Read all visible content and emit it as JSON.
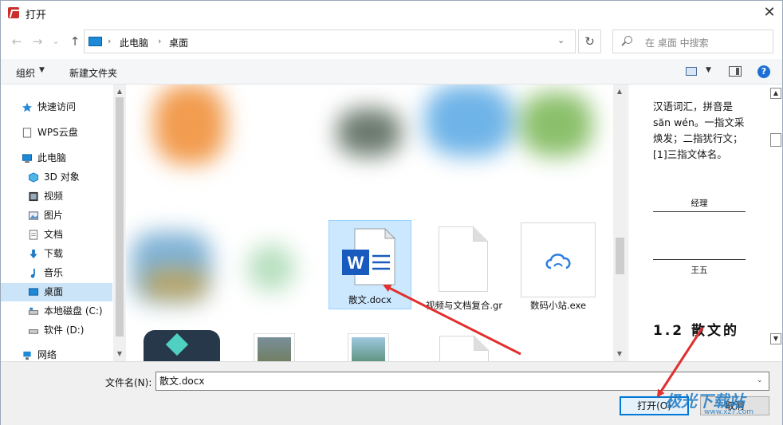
{
  "window": {
    "title": "打开",
    "close_glyph": "✕"
  },
  "navigation": {
    "back_glyph": "←",
    "forward_glyph": "→",
    "history_glyph": "⌄",
    "up_glyph": "↑",
    "breadcrumb": [
      "此电脑",
      "桌面"
    ],
    "breadcrumb_sep": "›",
    "dropdown_glyph": "⌄",
    "refresh_glyph": "↻",
    "search_placeholder": "在 桌面 中搜索"
  },
  "toolbar": {
    "organize_label": "组织",
    "organize_caret": "▼",
    "new_folder_label": "新建文件夹",
    "view_caret": "▼",
    "help_glyph": "?"
  },
  "sidebar": {
    "items": [
      {
        "label": "快速访问",
        "icon": "star-icon",
        "selected": false
      },
      {
        "label": "WPS云盘",
        "icon": "cloud-doc-icon",
        "selected": false
      },
      {
        "label": "此电脑",
        "icon": "computer-icon",
        "selected": false
      },
      {
        "label": "3D 对象",
        "icon": "cube-icon",
        "selected": false
      },
      {
        "label": "视频",
        "icon": "video-icon",
        "selected": false
      },
      {
        "label": "图片",
        "icon": "picture-icon",
        "selected": false
      },
      {
        "label": "文档",
        "icon": "document-icon",
        "selected": false
      },
      {
        "label": "下载",
        "icon": "download-icon",
        "selected": false
      },
      {
        "label": "音乐",
        "icon": "music-icon",
        "selected": false
      },
      {
        "label": "桌面",
        "icon": "desktop-icon",
        "selected": true
      },
      {
        "label": "本地磁盘 (C:)",
        "icon": "disk-icon",
        "selected": false
      },
      {
        "label": "软件 (D:)",
        "icon": "disk-icon",
        "selected": false
      },
      {
        "label": "网络",
        "icon": "network-icon",
        "selected": false
      }
    ],
    "scroll_up_glyph": "▲",
    "scroll_down_glyph": "▼"
  },
  "files": {
    "items": [
      {
        "name": "散文.docx",
        "icon": "word-doc-icon",
        "selected": true
      },
      {
        "name": "视频与文档复合.gr",
        "icon": "blank-file-icon",
        "selected": false
      },
      {
        "name": "数码小站.exe",
        "icon": "cloud-app-icon",
        "selected": false
      }
    ],
    "word_letter": "W",
    "scroll_up_glyph": "▲",
    "scroll_down_glyph": "▼"
  },
  "preview": {
    "paragraph": "汉语词汇，拼音是 săn wén。一指文采焕发；二指犹行文；[1]三指文体名。",
    "role_label": "经理",
    "name_label": "王五",
    "heading": "1.2 散文的",
    "scroll_up_glyph": "▲",
    "scroll_down_glyph": "▼"
  },
  "bottom": {
    "filename_label": "文件名(N):",
    "filename_value": "散文.docx",
    "dropdown_glyph": "⌄",
    "open_label": "打开(O)",
    "cancel_label": "取消"
  },
  "watermark": {
    "title": "极光下载站",
    "subtitle": "www.xz7.com"
  },
  "colors": {
    "accent": "#0078d7",
    "selection": "#cce8ff",
    "annotation_arrow": "#e0312f",
    "word_blue": "#185abd"
  }
}
